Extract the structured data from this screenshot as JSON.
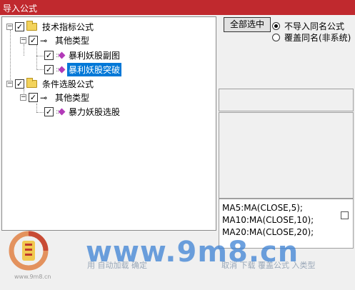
{
  "window": {
    "title": "导入公式"
  },
  "tree": {
    "nodes": [
      {
        "label": "技术指标公式",
        "type": "folder",
        "checked": true,
        "expanded": true
      },
      {
        "label": "其他类型",
        "type": "key",
        "checked": true,
        "expanded": true
      },
      {
        "label": "暴利妖股副图",
        "type": "formula",
        "checked": true
      },
      {
        "label": "暴利妖股突破",
        "type": "formula",
        "checked": true,
        "selected": true
      },
      {
        "label": "条件选股公式",
        "type": "folder",
        "checked": true,
        "expanded": true
      },
      {
        "label": "其他类型",
        "type": "key",
        "checked": true,
        "expanded": true
      },
      {
        "label": "暴力妖股选股",
        "type": "formula",
        "checked": true
      }
    ],
    "expander_symbol": "−",
    "check_symbol": "✓"
  },
  "options": {
    "select_all_label": "全部选中",
    "radio_skip_label": "不导入同名公式",
    "radio_overwrite_label": "覆盖同名(非系统)",
    "selected_radio": "skip"
  },
  "code_preview": {
    "lines": [
      "MA5:MA(CLOSE,5);",
      "MA10:MA(CLOSE,10);",
      "MA20:MA(CLOSE,20);"
    ]
  },
  "status": {
    "left_text": "用 自动加载   确定",
    "right_text": "取消 下载   覆盖公式 入类型"
  },
  "watermark": {
    "site": "www.9m8.cn",
    "logo_small": "www.9m8.cn",
    "colors": {
      "ring_orange": "#e07a3a",
      "ring_red": "#c0392b",
      "text_blue": "#347dd2"
    }
  },
  "colors": {
    "titlebar": "#c0292e",
    "selection": "#0078d7"
  }
}
